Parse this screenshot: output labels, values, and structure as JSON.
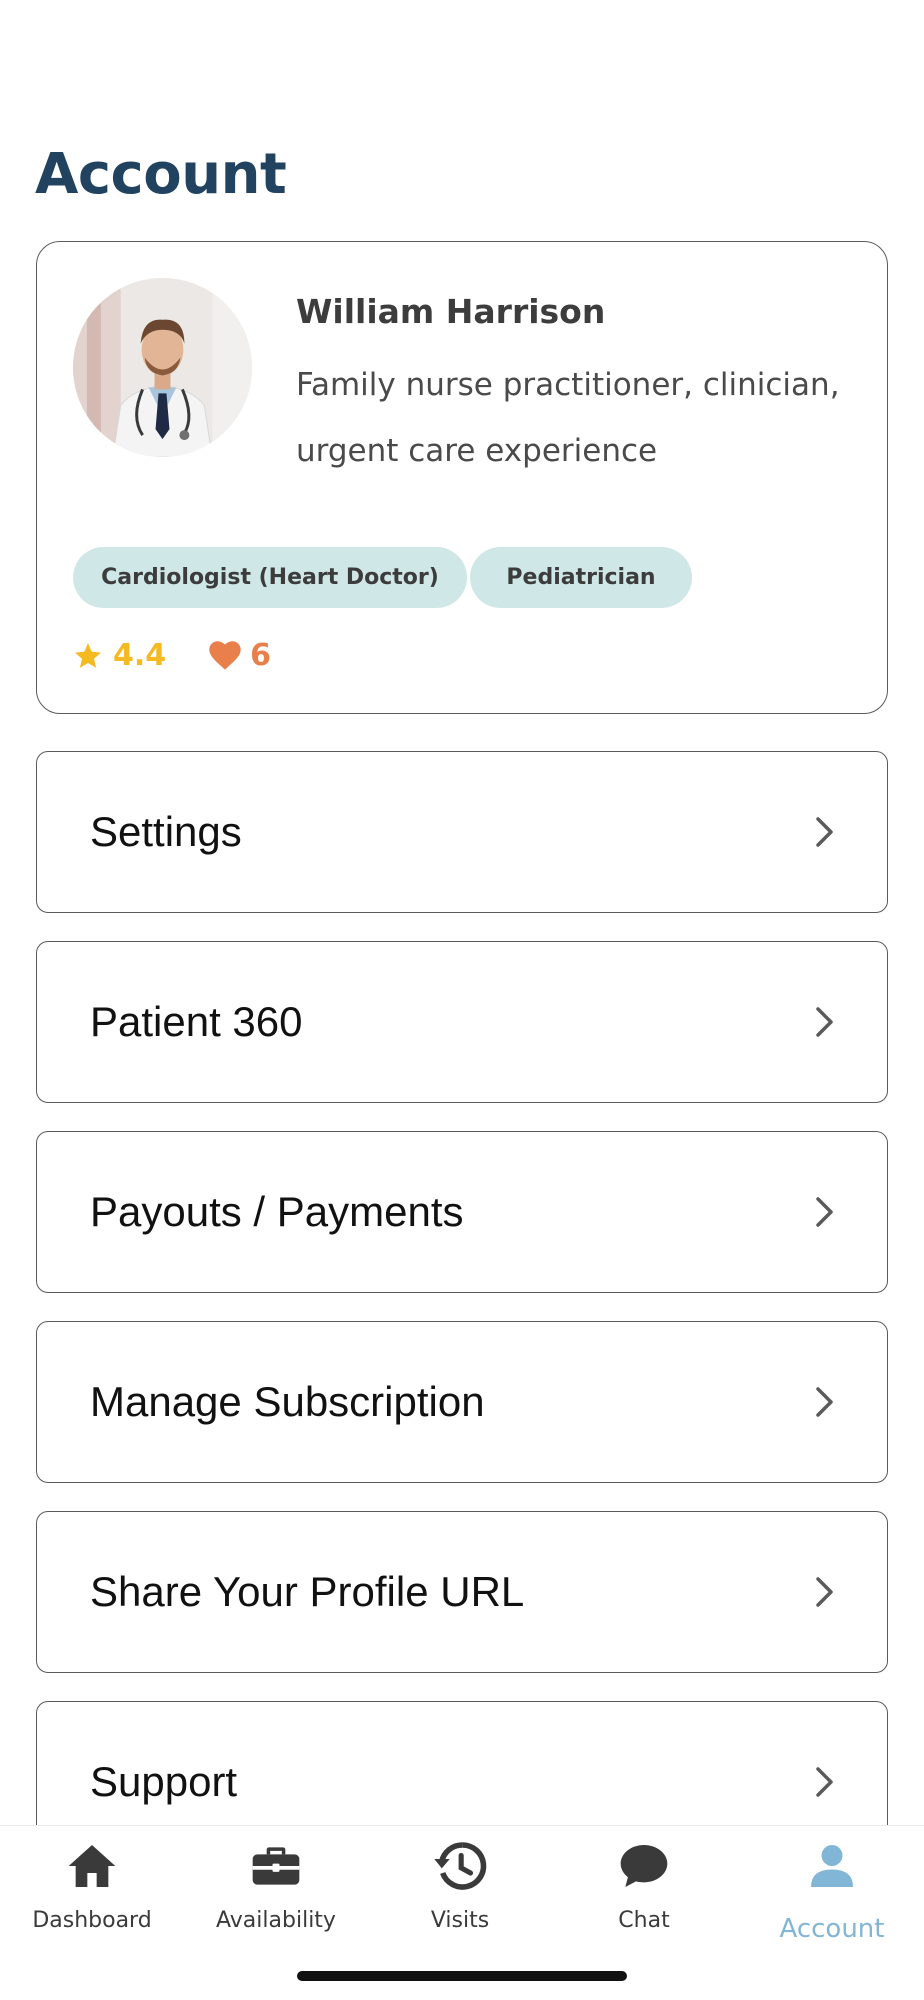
{
  "page": {
    "title": "Account"
  },
  "profile": {
    "name": "William Harrison",
    "description": "Family nurse practitioner, clinician, urgent care experience",
    "tags": [
      "Cardiologist (Heart Doctor)",
      "Pediatrician"
    ],
    "rating": "4.4",
    "likes": "6",
    "avatar_icon": "doctor-photo"
  },
  "menu": [
    {
      "label": "Settings"
    },
    {
      "label": "Patient 360"
    },
    {
      "label": "Payouts / Payments"
    },
    {
      "label": "Manage Subscription"
    },
    {
      "label": "Share Your Profile URL"
    },
    {
      "label": "Support"
    }
  ],
  "tab_bar": {
    "items": [
      {
        "label": "Dashboard",
        "icon": "home-icon"
      },
      {
        "label": "Availability",
        "icon": "briefcase-icon"
      },
      {
        "label": "Visits",
        "icon": "history-icon"
      },
      {
        "label": "Chat",
        "icon": "chat-bubble-icon"
      },
      {
        "label": "Account",
        "icon": "user-icon",
        "active": true
      }
    ]
  },
  "colors": {
    "title": "#22435f",
    "tag_bg": "#cfe7e6",
    "rating": "#f5b922",
    "likes": "#e9804b",
    "tab_active": "#82b6d6",
    "tab_inactive": "#3a3a3a"
  }
}
